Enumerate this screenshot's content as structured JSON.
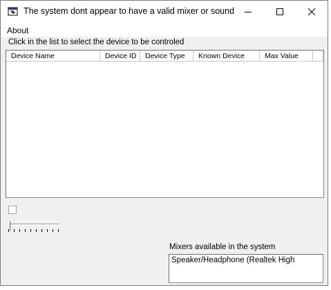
{
  "window": {
    "title": "The system dont appear to have a valid mixer or sound ..."
  },
  "menu": {
    "about_label": "About"
  },
  "instruction": "Click in the list to select the device to be controled",
  "device_list": {
    "columns": [
      "Device Name",
      "Device ID",
      "Device Type",
      "Known Device",
      "Max Value"
    ],
    "rows": []
  },
  "checkbox": {
    "checked": false
  },
  "slider": {
    "value": 0
  },
  "mixers": {
    "label": "Mixers available in the system",
    "items": [
      "Speaker/Headphone (Realtek High"
    ]
  },
  "icons": {
    "app": "app-window-icon",
    "minimize": "minimize-icon",
    "maximize": "maximize-icon",
    "close": "close-icon"
  }
}
